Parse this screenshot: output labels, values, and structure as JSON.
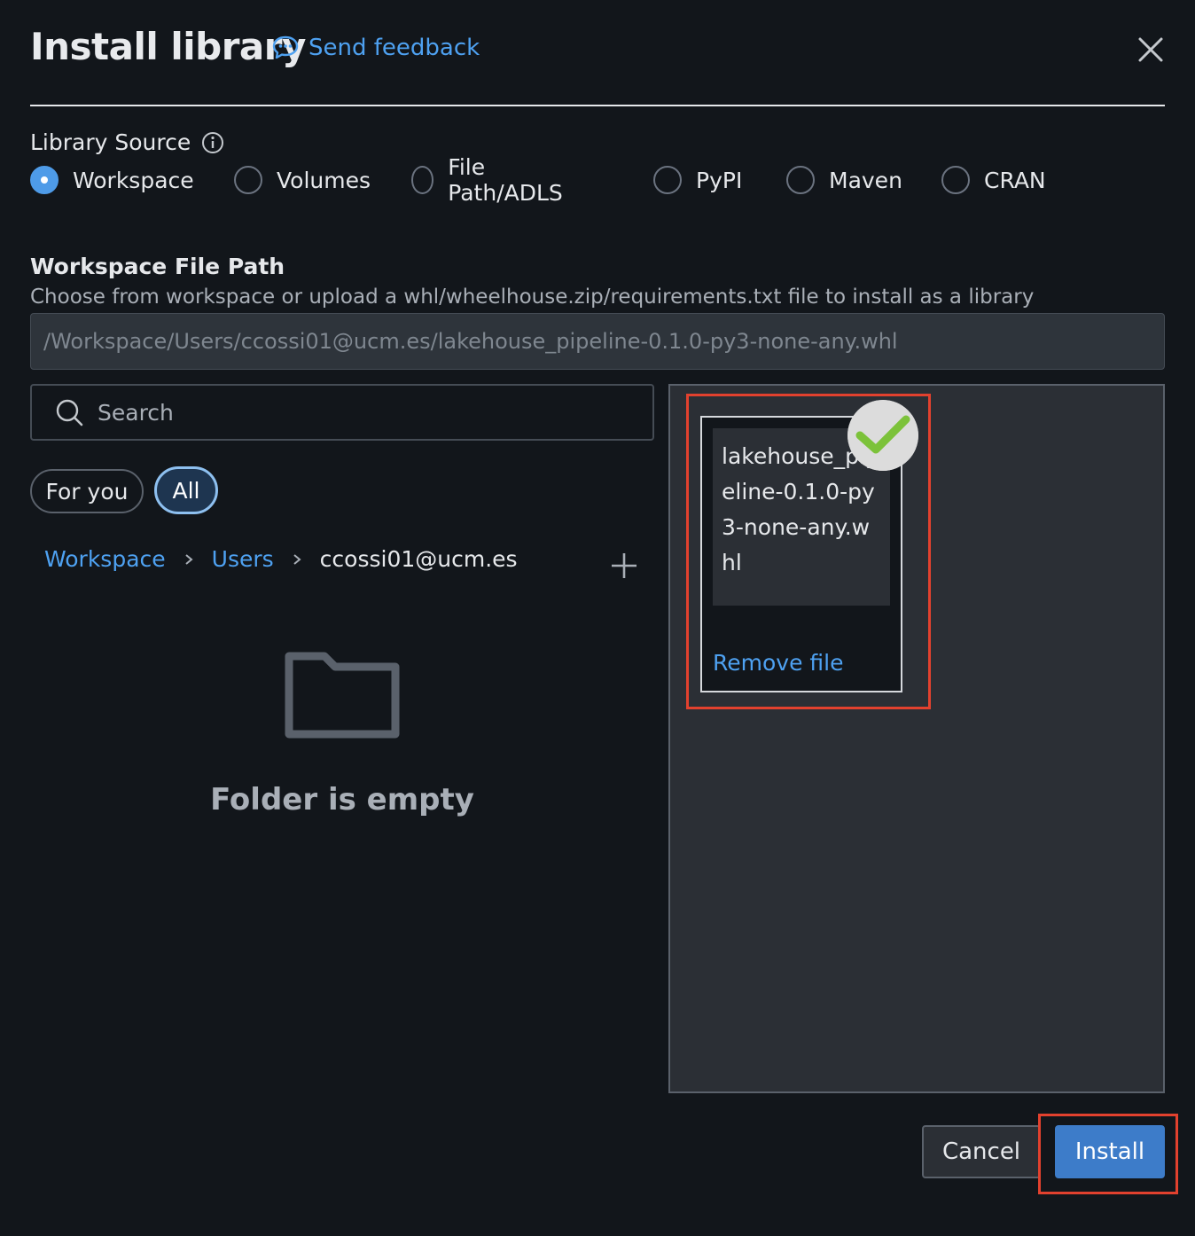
{
  "header": {
    "title": "Install library",
    "feedback_label": "Send feedback"
  },
  "library_source": {
    "label": "Library Source",
    "options": [
      "Workspace",
      "Volumes",
      "File Path/ADLS",
      "PyPI",
      "Maven",
      "CRAN"
    ],
    "selected": "Workspace"
  },
  "file_path": {
    "title": "Workspace File Path",
    "description": "Choose from workspace or upload a whl/wheelhouse.zip/requirements.txt file to install as a library",
    "value": "/Workspace/Users/ccossi01@ucm.es/lakehouse_pipeline-0.1.0-py3-none-any.whl"
  },
  "browser": {
    "search_placeholder": "Search",
    "filters": [
      "For you",
      "All"
    ],
    "active_filter": "All",
    "breadcrumb": [
      "Workspace",
      "Users",
      "ccossi01@ucm.es"
    ],
    "empty_message": "Folder is empty"
  },
  "upload": {
    "file_name": "lakehouse_pipeline-0.1.0-py3-none-any.whl",
    "remove_label": "Remove file"
  },
  "footer": {
    "cancel_label": "Cancel",
    "install_label": "Install"
  },
  "colors": {
    "background": "#12161b",
    "accent": "#4ea1f1",
    "primary_button": "#3d7cc9",
    "highlight": "#e2412e",
    "check": "#7cc23a"
  },
  "icons": [
    "feedback-icon",
    "close-icon",
    "info-icon",
    "search-icon",
    "chevron-right-icon",
    "plus-icon",
    "folder-icon",
    "check-icon"
  ]
}
